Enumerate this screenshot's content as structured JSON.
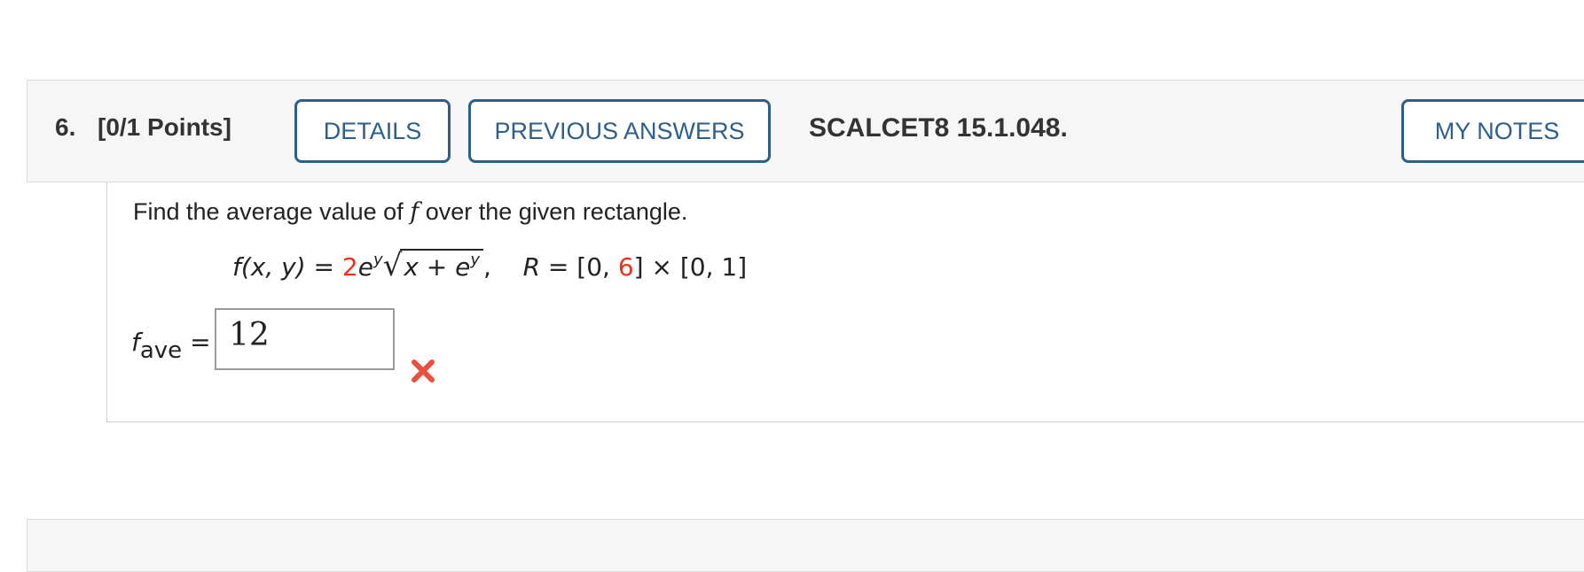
{
  "question": {
    "number": "6.",
    "points": "[0/1 Points]",
    "details_label": "DETAILS",
    "previous_answers_label": "PREVIOUS ANSWERS",
    "reference": "SCALCET8 15.1.048.",
    "my_notes_label": "MY NOTES"
  },
  "body": {
    "prompt_before": "Find the average value of ",
    "prompt_var": "f",
    "prompt_after": " over the given rectangle.",
    "formula": {
      "lhs": "f(x, y)",
      "equals": " = ",
      "coef": "2",
      "base": "e",
      "exp": "y",
      "radicand_a": "x + ",
      "radicand_e": "e",
      "radicand_exp": "y",
      "comma": ",",
      "r_label": "R",
      "r_equals": " = [0, ",
      "r_upper": "6",
      "r_rest": "] × [0, 1]"
    },
    "fave_f": "f",
    "fave_sub": "ave",
    "fave_equals": " = ",
    "answer_value": "12",
    "status_icon": "wrong-x-icon",
    "status_color": "#e8321e"
  }
}
